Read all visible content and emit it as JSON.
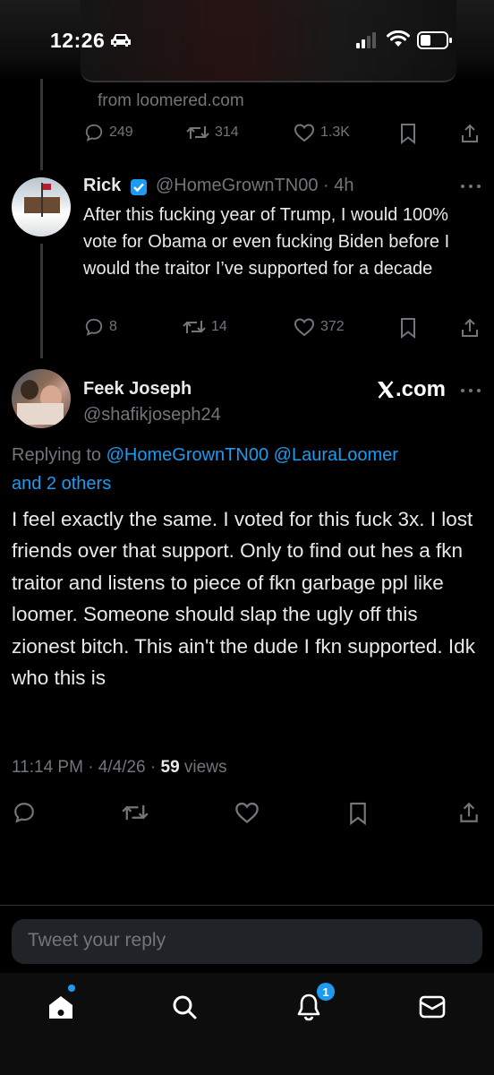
{
  "status_bar": {
    "time": "12:26"
  },
  "quoted_tweet": {
    "source": "from loomered.com",
    "replies": "249",
    "reposts": "314",
    "likes": "1.3K"
  },
  "rick_tweet": {
    "name": "Rick",
    "handle": "@HomeGrownTN00 · 4h",
    "text": "After this fucking year of Trump, I would 100% vote for Obama or even fucking Biden before I would the traitor I’ve supported for a decade",
    "replies": "8",
    "reposts": "14",
    "likes": "372"
  },
  "main_tweet": {
    "name": "Feek Joseph",
    "handle": "@shafikjoseph24",
    "badge": ".com",
    "replying_to_prefix": "Replying to ",
    "mention_1": "@HomeGrownTN00",
    "mention_2": "@LauraLoomer",
    "mention_others": "and 2 others",
    "text": "I feel exactly the same. I voted for this fuck 3x. I lost friends over that support. Only to find out hes a fkn traitor and listens to piece of fkn garbage ppl like loomer. Someone should slap the ugly off this zionest bitch. This ain't the dude I fkn supported. Idk who this is",
    "time": "11:14 PM · 4/4/26 · ",
    "views_count": "59",
    "views_label": " views"
  },
  "reply_box": {
    "placeholder": "Tweet your reply"
  },
  "bottom_nav": {
    "notifications_badge": "1"
  },
  "colors": {
    "accent": "#1d9bf0",
    "muted": "#71767b",
    "text": "#e7e9ea",
    "background": "#000000"
  }
}
